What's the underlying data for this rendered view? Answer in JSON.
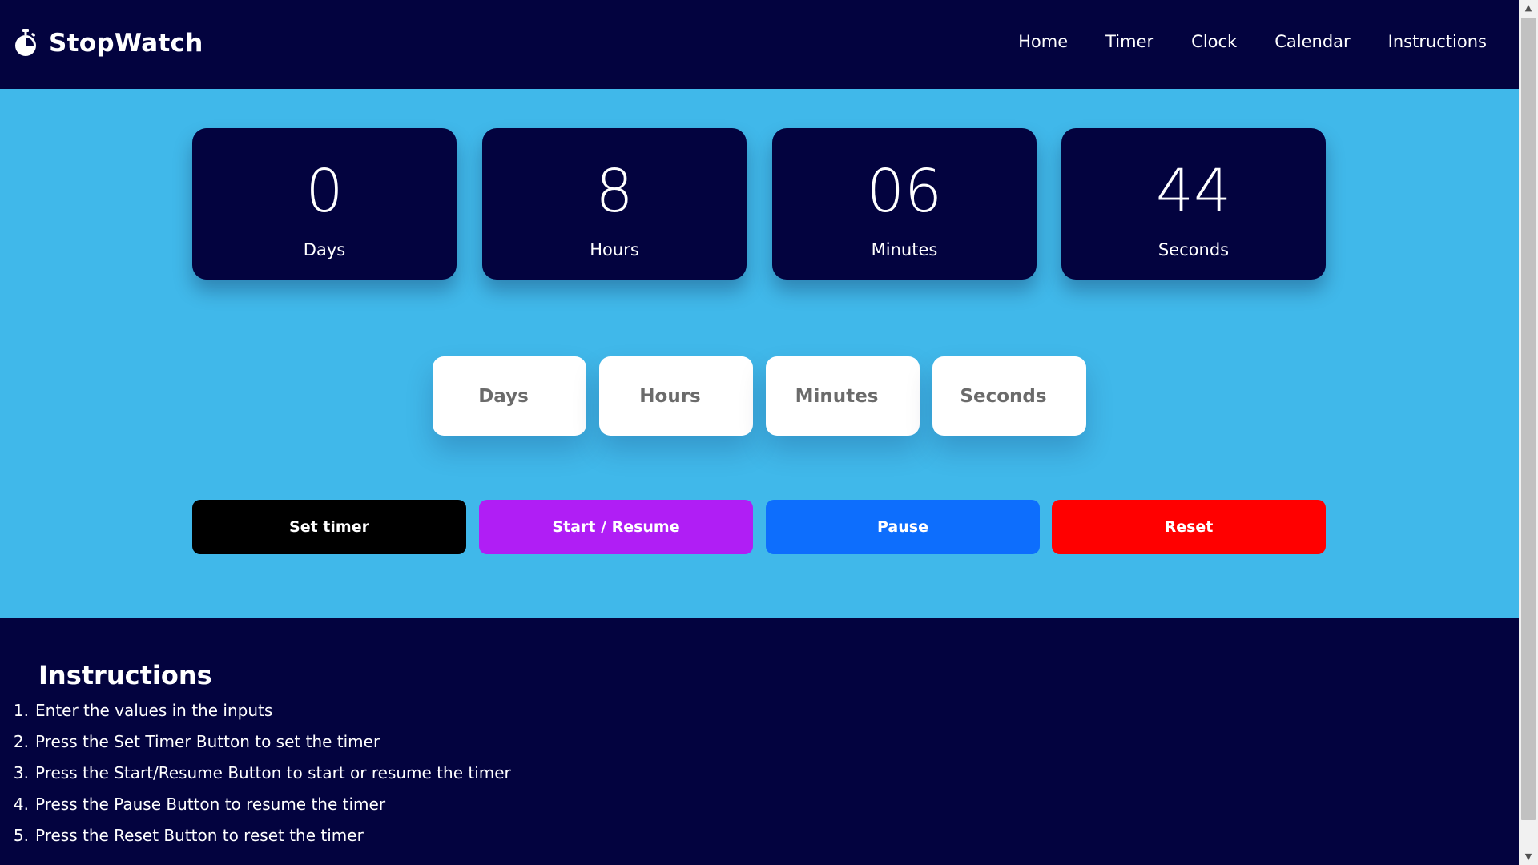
{
  "navbar": {
    "brand_icon": "stopwatch-icon",
    "brand_title": "StopWatch",
    "links": [
      "Home",
      "Timer",
      "Clock",
      "Calendar",
      "Instructions"
    ]
  },
  "counter": {
    "days": {
      "value": "0",
      "label": "Days"
    },
    "hours": {
      "value": "8",
      "label": "Hours"
    },
    "minutes": {
      "value": "06",
      "label": "Minutes"
    },
    "seconds": {
      "value": "44",
      "label": "Seconds"
    }
  },
  "inputs": {
    "days_placeholder": "Days",
    "hours_placeholder": "Hours",
    "minutes_placeholder": "Minutes",
    "seconds_placeholder": "Seconds"
  },
  "buttons": {
    "set_timer": "Set timer",
    "start_resume": "Start / Resume",
    "pause": "Pause",
    "reset": "Reset"
  },
  "instructions": {
    "title": "Instructions",
    "items": [
      {
        "num": "1.",
        "text": "Enter the values in the inputs"
      },
      {
        "num": "2.",
        "text": "Press the Set Timer Button to set the timer"
      },
      {
        "num": "3.",
        "text": "Press the Start/Resume Button to start or resume the timer"
      },
      {
        "num": "4.",
        "text": "Press the Pause Button to resume the timer"
      },
      {
        "num": "5.",
        "text": "Press the Reset Button to reset the timer"
      }
    ]
  },
  "colors": {
    "navy": "#03033f",
    "sky": "#40b8ea",
    "set_timer_bg": "#000000",
    "start_bg": "#b01ef5",
    "pause_bg": "#0d6efd",
    "reset_bg": "#ff0000"
  }
}
